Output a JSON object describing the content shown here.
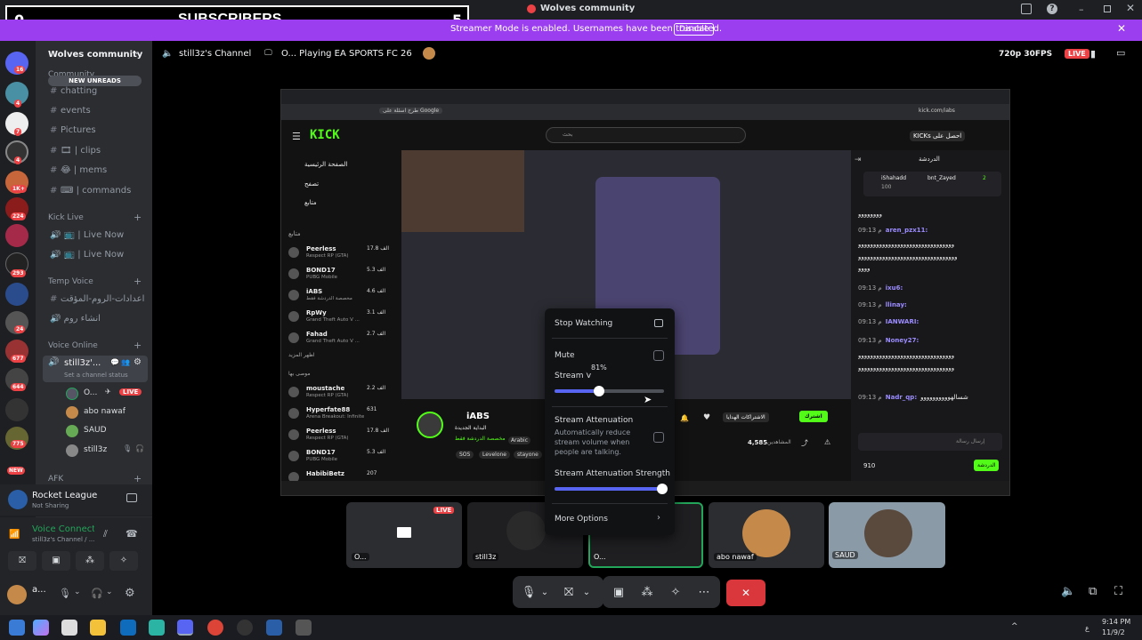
{
  "overlay": {
    "left_count": "0",
    "label": "SUBSCRIBERS",
    "right_count": "5"
  },
  "window": {
    "title": "Wolves community"
  },
  "banner": {
    "message": "Streamer Mode is enabled. Usernames have been truncated.",
    "disable_label": "Disable"
  },
  "server": {
    "name": "Wolves community",
    "new_unreads": "NEW UNREADS"
  },
  "guild_badges": [
    "16",
    "4",
    "7",
    "4",
    "1K+",
    "224",
    "293",
    "24",
    "677",
    "644",
    "775",
    "NEW"
  ],
  "categories": {
    "community": "Community",
    "kick_live": "Kick Live",
    "temp_voice": "Temp Voice",
    "voice_online": "Voice Online",
    "afk": "AFK"
  },
  "channels": {
    "chatting": "chatting",
    "events": "events",
    "pictures": "Pictures",
    "clips": "clips",
    "mems": "mems",
    "commands": "commands",
    "live_now_1": "Live Now",
    "live_now_2": "Live Now",
    "temp_settings": "اعدادات-الروم-المؤقت",
    "create_room": "انشاء روم",
    "voice_channel": "still3z'...",
    "voice_status": "Set a channel status"
  },
  "voice_users": [
    {
      "name": "O...",
      "live": "LIVE"
    },
    {
      "name": "abo nawaf"
    },
    {
      "name": "SAUD"
    },
    {
      "name": "still3z"
    }
  ],
  "activity": {
    "game": "Rocket League",
    "status": "Not Sharing"
  },
  "voice": {
    "status": "Voice Connected",
    "channel": "still3z's Channel / ..."
  },
  "user": {
    "name": "a..."
  },
  "stream_header": {
    "channel": "still3z's Channel",
    "activity": "O... Playing EA SPORTS FC 26",
    "quality": "720p 30FPS",
    "live": "LIVE"
  },
  "browser": {
    "url": "kick.com/iabs",
    "search": "بحث",
    "signin": "KICKs احصل على",
    "bookmark": "طرح اسئلة على Google"
  },
  "kick_nav": {
    "logo": "KICK",
    "home": "الصفحة الرئيسية",
    "browse": "تصفح",
    "following": "متابع",
    "following_header": "متابع",
    "recommended": "موصى بها",
    "show_more": "اظهر المزيد"
  },
  "kick_followed": [
    {
      "name": "Peerless",
      "game": "Respect RP (GTA)",
      "viewers": "17.8 الف"
    },
    {
      "name": "BOND17",
      "game": "PUBG Mobile",
      "viewers": "5.3 الف"
    },
    {
      "name": "iABS",
      "game": "مخصصة الدردشة فقط",
      "viewers": "4.6 الف"
    },
    {
      "name": "RpWy",
      "game": "Grand Theft Auto V ...",
      "viewers": "3.1 الف"
    },
    {
      "name": "Fahad",
      "game": "Grand Theft Auto V ...",
      "viewers": "2.7 الف"
    }
  ],
  "kick_recommended": [
    {
      "name": "moustache",
      "game": "Respect RP (GTA)",
      "viewers": "2.2 الف"
    },
    {
      "name": "Hyperfate88",
      "game": "Arena Breakout: Infinite",
      "viewers": "631"
    },
    {
      "name": "Peerless",
      "game": "Respect RP (GTA)",
      "viewers": "17.8 الف"
    },
    {
      "name": "BOND17",
      "game": "PUBG Mobile",
      "viewers": "5.3 الف"
    },
    {
      "name": "HabibiBetz",
      "game": "",
      "viewers": "207"
    }
  ],
  "kick_stream": {
    "streamer": "iABS",
    "title": "البداية الجديدة",
    "category": "مخصصة الدردشة فقط",
    "tags": [
      "SOS",
      "Levelone",
      "stayone"
    ],
    "language": "Arabic",
    "viewers": "4,585",
    "viewers_label": "المشاهدين",
    "follow": "الاشتراكات الهدايا",
    "subscribe": "اشترك"
  },
  "kick_chat": {
    "title": "الدردشة",
    "pinned_user": "iShahadd",
    "pinned_count": "100",
    "gift_user": "bnt_Zayed",
    "gift_count": "2",
    "lines": [
      {
        "time": "",
        "user": "",
        "text": "وووووووو"
      },
      {
        "time": "09:13 م",
        "user": "aren_pzx11:",
        "text": ""
      },
      {
        "time": "",
        "user": "",
        "text": "وووووووووووووووووووووووووووووووو"
      },
      {
        "time": "",
        "user": "",
        "text": "ووووووووووووووووووووووووووووووووو"
      },
      {
        "time": "",
        "user": "",
        "text": "وووو"
      },
      {
        "time": "09:13 م",
        "user": "ixu6:",
        "text": ""
      },
      {
        "time": "09:13 م",
        "user": "llinay:",
        "text": ""
      },
      {
        "time": "09:13 م",
        "user": "IANWARI:",
        "text": ""
      },
      {
        "time": "09:13 م",
        "user": "Noney27:",
        "text": ""
      },
      {
        "time": "",
        "user": "",
        "text": "وووووووووووووووووووووووووووووووو"
      },
      {
        "time": "",
        "user": "",
        "text": "وووووووووووووووووووووووووووووووو"
      },
      {
        "time": "09:13 م",
        "user": "Nadr_qp:",
        "text": "شسالهوووووووووو"
      }
    ],
    "input_placeholder": "إرسال رسالة",
    "points": "910",
    "send": "الدردشة"
  },
  "tile_labels": {
    "tile1": "O...",
    "tile2": "still3z",
    "tile3": "O...",
    "tile4": "abo nawaf",
    "tile5": "SAUD",
    "live": "LIVE"
  },
  "stream_menu": {
    "stop_watching": "Stop Watching",
    "mute": "Mute",
    "stream_volume": "Stream V",
    "volume_tooltip": "81%",
    "volume_value": 0.81,
    "attenuation_title": "Stream Attenuation",
    "attenuation_desc_1": "Automatically reduce",
    "attenuation_desc_2": "stream volume when",
    "attenuation_desc_3": "people are talking.",
    "attenuation_strength": "Stream Attenuation Strength",
    "strength_value": 1.0,
    "more_options": "More Options"
  },
  "taskbar": {
    "time": "9:14 PM",
    "date": "11/9/2",
    "lang": "ع"
  },
  "colors": {
    "accent": "#5865f2",
    "live": "#ed4245",
    "kick_green": "#53fc18",
    "banner": "#9b3ef0",
    "voice_green": "#23a55a"
  }
}
